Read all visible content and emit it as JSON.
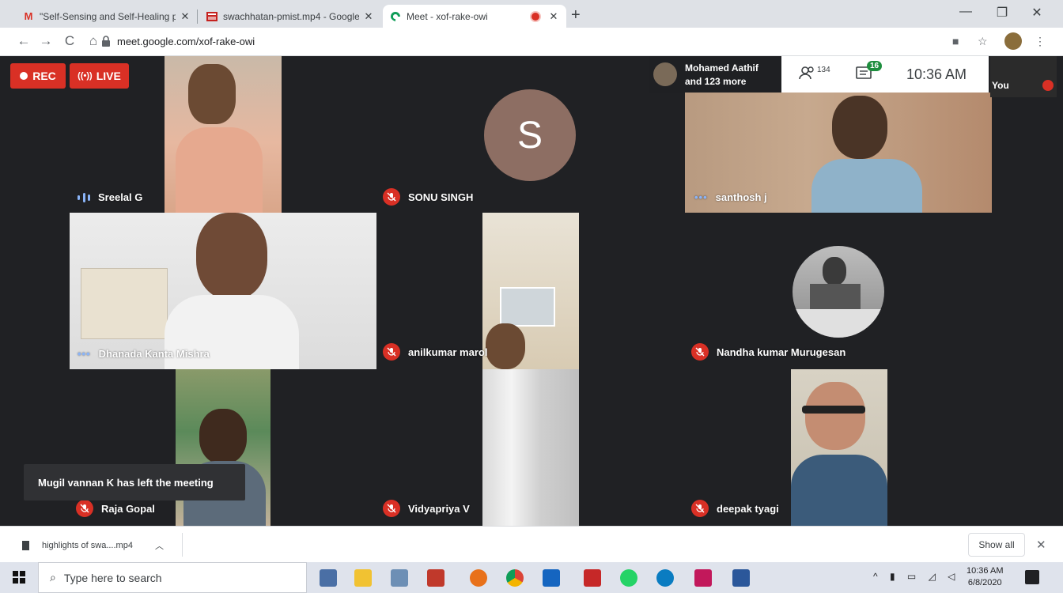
{
  "browser": {
    "tabs": [
      {
        "title": "\"Self-Sensing and Self-Healing p",
        "icon": "gmail-icon"
      },
      {
        "title": "swachhatan-pmist.mp4 - Google",
        "icon": "video-file-icon"
      },
      {
        "title": "Meet - xof-rake-owi",
        "icon": "meet-icon"
      }
    ],
    "url": "meet.google.com/xof-rake-owi"
  },
  "meet": {
    "rec_label": "REC",
    "live_label": "LIVE",
    "presenter": {
      "line1": "Mohamed Aathif",
      "line2": "and 123 more"
    },
    "participants_count": "134",
    "chat_count": "16",
    "time": "10:36 AM",
    "self_label": "You",
    "tiles": [
      {
        "name": "Sreelal G",
        "status": "speaking"
      },
      {
        "name": "SONU SINGH",
        "status": "muted",
        "initial": "S"
      },
      {
        "name": "santhosh j",
        "status": "active"
      },
      {
        "name": "Dhanada Kanta Mishra",
        "status": "active"
      },
      {
        "name": "anilkumar marol",
        "status": "muted"
      },
      {
        "name": "Nandha kumar Murugesan",
        "status": "muted"
      },
      {
        "name": "Raja Gopal",
        "status": "muted"
      },
      {
        "name": "Vidyapriya V",
        "status": "muted"
      },
      {
        "name": "deepak tyagi",
        "status": "muted"
      }
    ],
    "toast": "Mugil vannan K has left the meeting"
  },
  "downloads": {
    "file": "highlights of swa....mp4",
    "show_all": "Show all"
  },
  "taskbar": {
    "search_placeholder": "Type here to search",
    "clock_time": "10:36 AM",
    "clock_date": "6/8/2020"
  },
  "colors": {
    "accent_red": "#d93025",
    "meet_bg": "#202124",
    "speak_blue": "#8ab4f8"
  }
}
